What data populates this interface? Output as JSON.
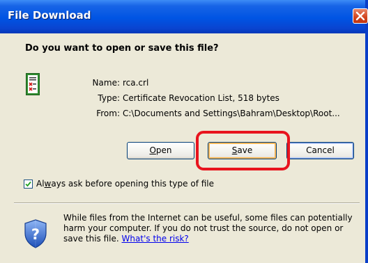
{
  "dialog": {
    "title": "File Download",
    "question": "Do you want to open or save this file?"
  },
  "file": {
    "name_label": "Name:",
    "name": "rca.crl",
    "type_label": "Type:",
    "type": "Certificate Revocation List, 518 bytes",
    "from_label": "From:",
    "from": "C:\\Documents and Settings\\Bahram\\Desktop\\Root..."
  },
  "buttons": {
    "open_mnemonic": "O",
    "open_rest": "pen",
    "save_mnemonic": "S",
    "save_rest": "ave",
    "cancel": "Cancel"
  },
  "checkbox": {
    "checked": true,
    "label_pre": "Al",
    "label_mnemonic": "w",
    "label_post": "ays ask before opening this type of file"
  },
  "warning": {
    "text": "While files from the Internet can be useful, some files can potentially harm your computer. If you do not trust the source, do not open or save this file.",
    "link": "What's the risk?"
  },
  "icons": {
    "close": "close-icon",
    "file": "certificate-file-icon",
    "security": "security-shield-icon",
    "check": "checkmark-icon"
  },
  "colors": {
    "titlebar": "#0054e3",
    "highlight": "#e8141e",
    "link": "#0000ee",
    "dialog_background": "#ece9d8"
  }
}
